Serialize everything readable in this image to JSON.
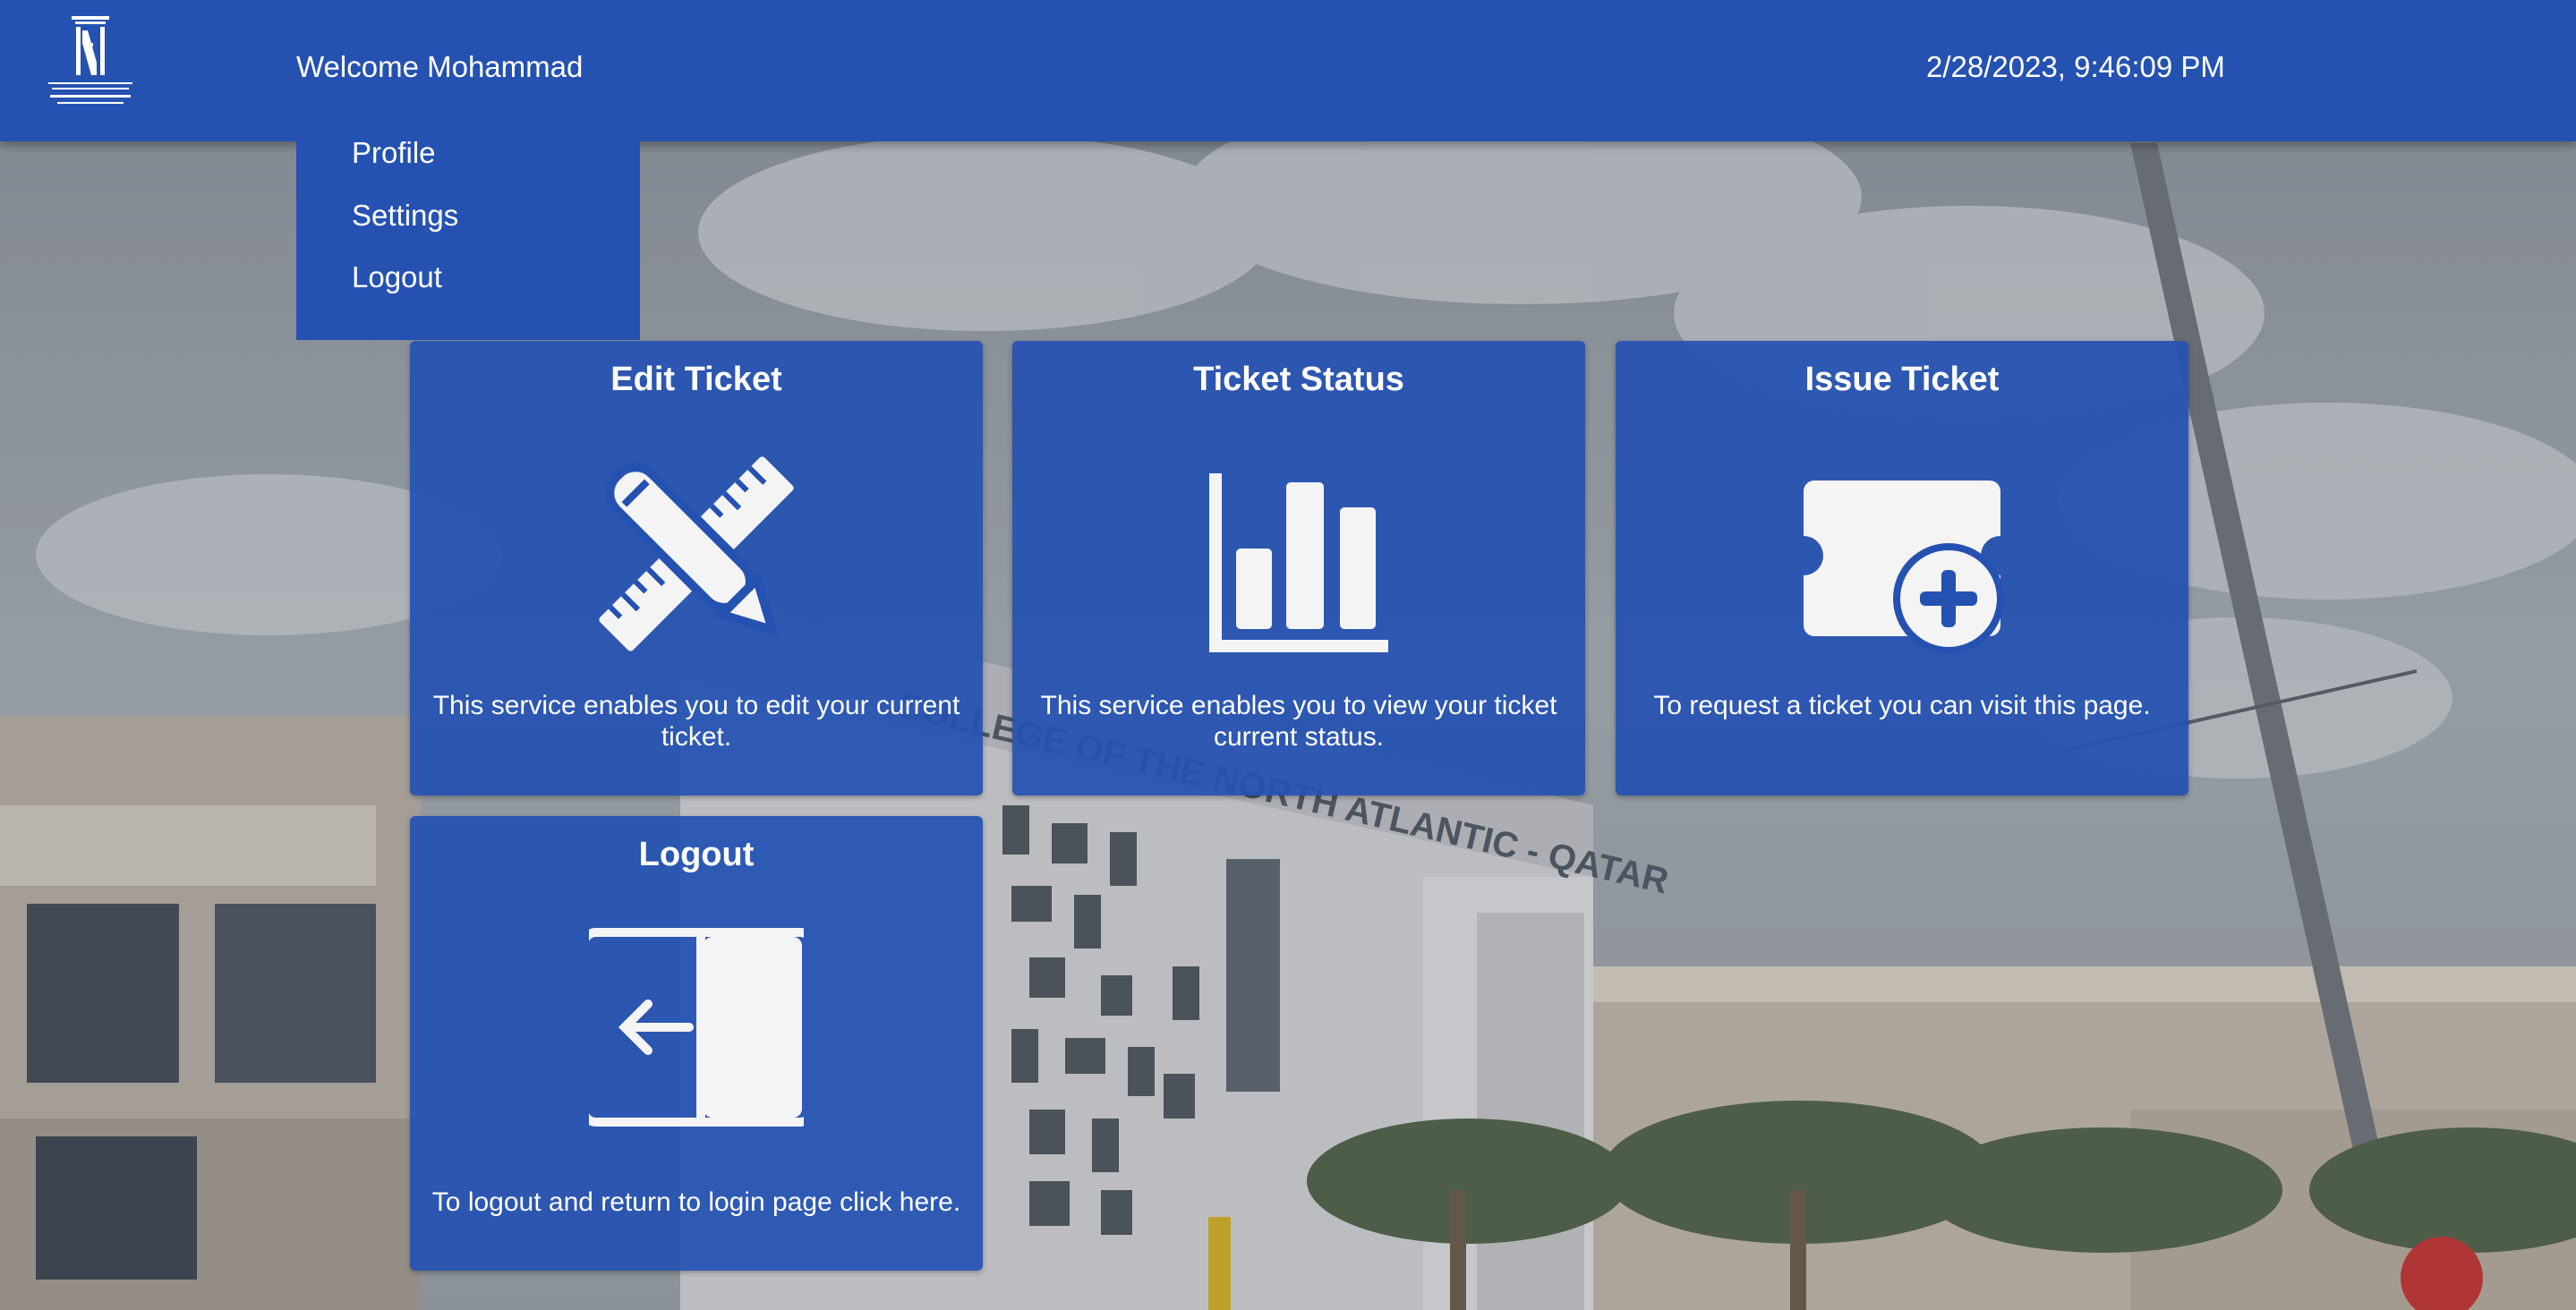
{
  "header": {
    "logo_lines": [
      "جامعة الدوحة",
      "للعلوم والتكنولوجيا",
      "UNIVERSITY OF DOHA",
      "FOR SCIENCE & TECHNOLOGY"
    ],
    "welcome": "Welcome Mohammad",
    "datetime": "2/28/2023, 9:46:09 PM"
  },
  "menu": {
    "items": [
      {
        "label": "Profile"
      },
      {
        "label": "Settings"
      },
      {
        "label": "Logout"
      }
    ]
  },
  "cards": [
    {
      "title": "Edit Ticket",
      "icon": "ruler-pencil-icon",
      "description": "This service enables you to edit your current ticket."
    },
    {
      "title": "Ticket Status",
      "icon": "bar-chart-icon",
      "description": "This service enables you to view your ticket current status."
    },
    {
      "title": "Issue Ticket",
      "icon": "ticket-plus-icon",
      "description": "To request a ticket you can visit this page."
    },
    {
      "title": "Logout",
      "icon": "logout-panel-icon",
      "description": "To logout and return to login page click here."
    }
  ],
  "background": {
    "building_sign": "COLLEGE OF THE NORTH ATLANTIC - QATAR"
  },
  "colors": {
    "primary": "#2552b1",
    "text": "#ffffff"
  }
}
